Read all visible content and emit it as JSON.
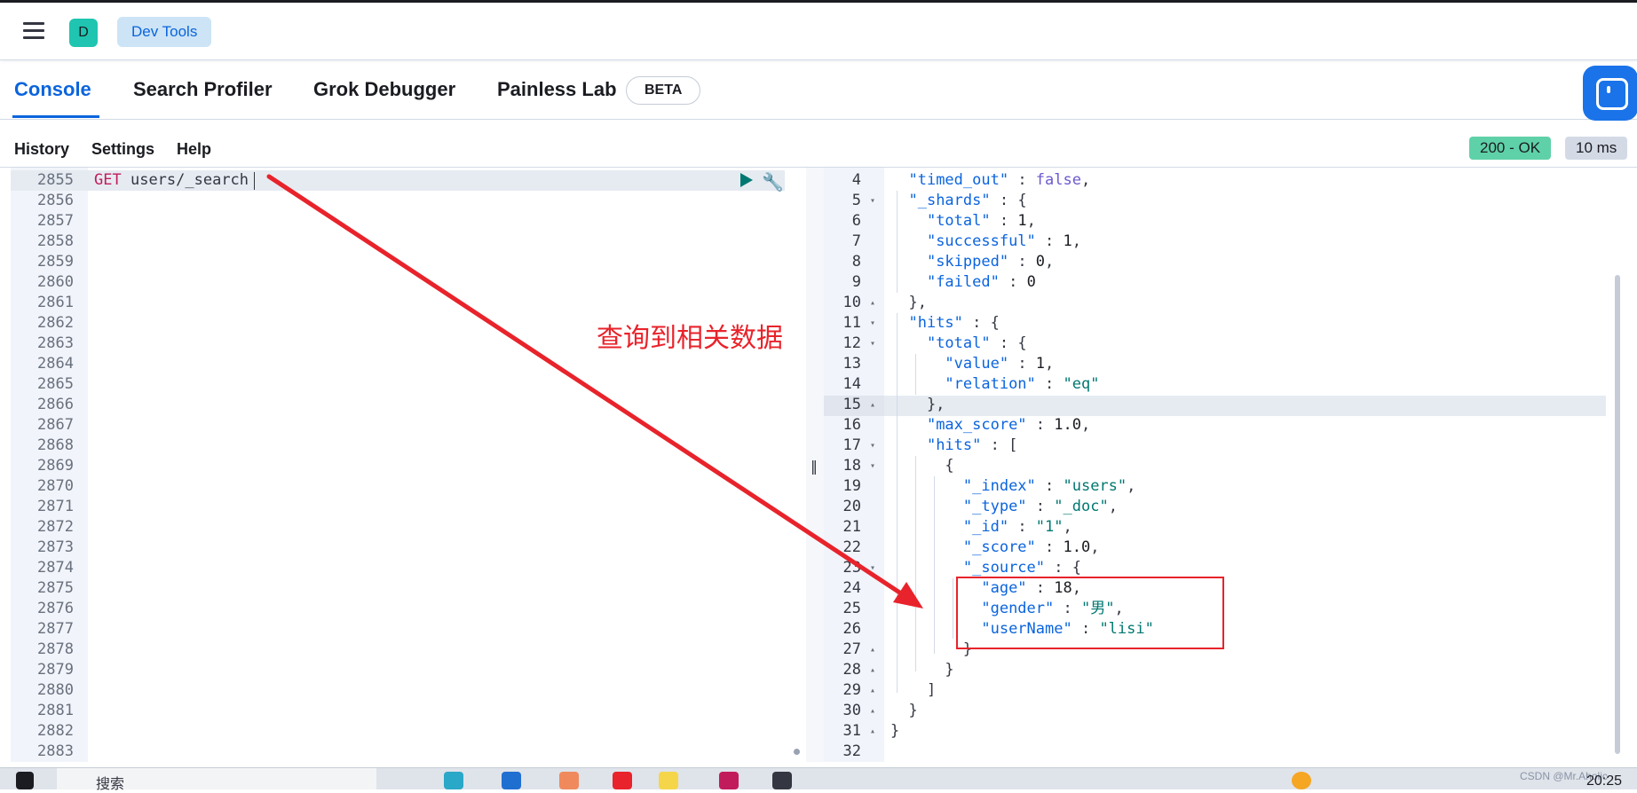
{
  "app": {
    "space_initial": "D",
    "breadcrumb": "Dev Tools"
  },
  "tabs": [
    "Console",
    "Search Profiler",
    "Grok Debugger",
    "Painless Lab"
  ],
  "beta_badge": "BETA",
  "toolbar": {
    "history": "History",
    "settings": "Settings",
    "help": "Help"
  },
  "response_status": {
    "status": "200 - OK",
    "time": "10 ms"
  },
  "request": {
    "line_numbers": [
      "2855",
      "2856",
      "2857",
      "2858",
      "2859",
      "2860",
      "2861",
      "2862",
      "2863",
      "2864",
      "2865",
      "2866",
      "2867",
      "2868",
      "2869",
      "2870",
      "2871",
      "2872",
      "2873",
      "2874",
      "2875",
      "2876",
      "2877",
      "2878",
      "2879",
      "2880",
      "2881",
      "2882",
      "2883"
    ],
    "method": "GET",
    "path": "users/_search"
  },
  "response": {
    "line_numbers": [
      "4",
      "5",
      "6",
      "7",
      "8",
      "9",
      "10",
      "11",
      "12",
      "13",
      "14",
      "15",
      "16",
      "17",
      "18",
      "19",
      "20",
      "21",
      "22",
      "23",
      "24",
      "25",
      "26",
      "27",
      "28",
      "29",
      "30",
      "31",
      "32"
    ],
    "lines": [
      "  \"timed_out\" : false,",
      "  \"_shards\" : {",
      "    \"total\" : 1,",
      "    \"successful\" : 1,",
      "    \"skipped\" : 0,",
      "    \"failed\" : 0",
      "  },",
      "  \"hits\" : {",
      "    \"total\" : {",
      "      \"value\" : 1,",
      "      \"relation\" : \"eq\"",
      "    },",
      "    \"max_score\" : 1.0,",
      "    \"hits\" : [",
      "      {",
      "        \"_index\" : \"users\",",
      "        \"_type\" : \"_doc\",",
      "        \"_id\" : \"1\",",
      "        \"_score\" : 1.0,",
      "        \"_source\" : {",
      "          \"age\" : 18,",
      "          \"gender\" : \"男\",",
      "          \"userName\" : \"lisi\"",
      "        }",
      "      }",
      "    ]",
      "  }",
      "}",
      ""
    ]
  },
  "annotation": "查询到相关数据",
  "taskbar": {
    "search_placeholder": "搜索",
    "time": "20:25"
  },
  "watermark": "CSDN @Mr.Aholic",
  "colors": {
    "accent": "#0b64dd",
    "status_ok": "#5fd1a8",
    "annotation": "#e8232b"
  }
}
